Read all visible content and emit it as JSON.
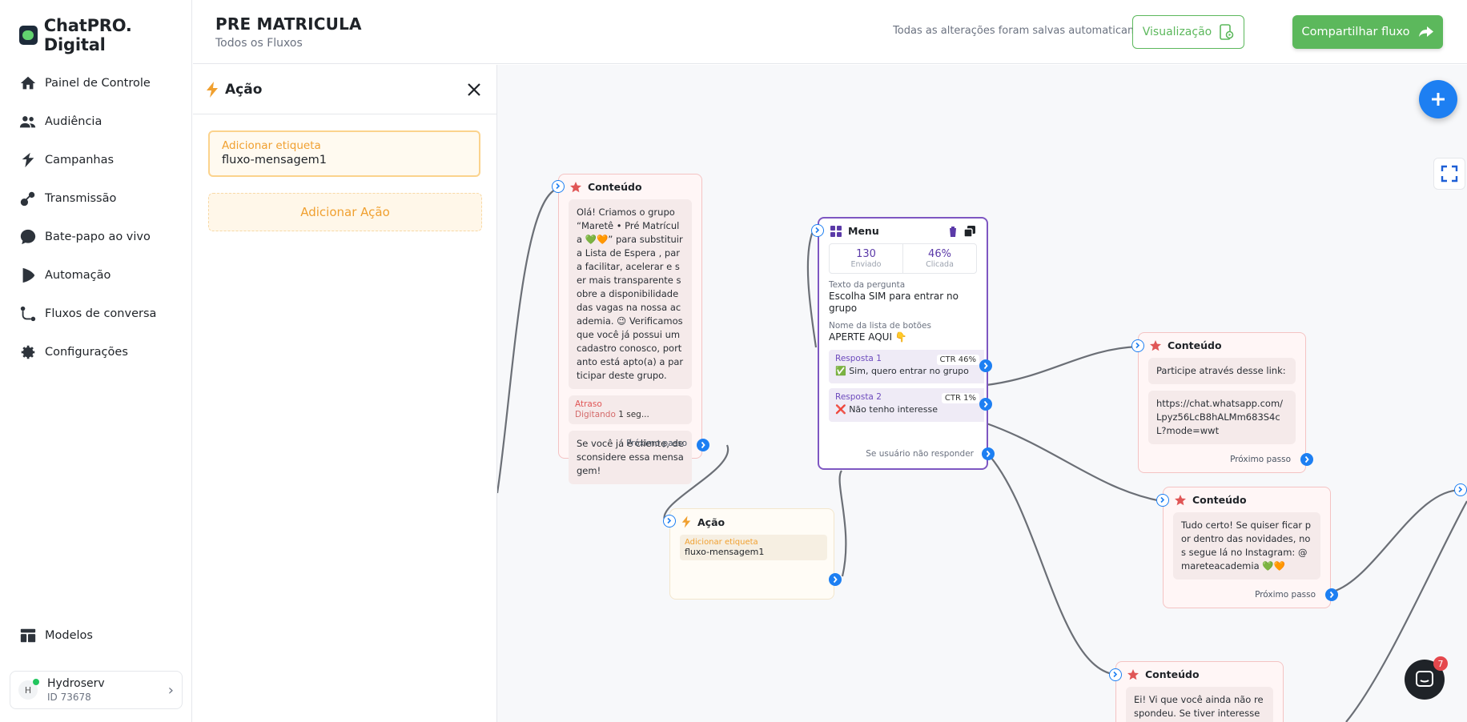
{
  "brand": {
    "name": "ChatPRO. Digital"
  },
  "nav": {
    "items": [
      {
        "label": "Painel de Controle"
      },
      {
        "label": "Audiência"
      },
      {
        "label": "Campanhas"
      },
      {
        "label": "Transmissão"
      },
      {
        "label": "Bate-papo ao vivo"
      },
      {
        "label": "Automação"
      },
      {
        "label": "Fluxos de conversa"
      },
      {
        "label": "Configurações"
      }
    ],
    "models_label": "Modelos"
  },
  "account": {
    "initial": "H",
    "name": "Hydroserv",
    "id": "ID 73678"
  },
  "header": {
    "title": "PRE MATRICULA",
    "breadcrumb": "Todos os Fluxos",
    "save_status": "Todas as alterações foram salvas automaticamente",
    "preview_label": "Visualização",
    "share_label": "Compartilhar fluxo"
  },
  "panel": {
    "title": "Ação",
    "tag_label": "Adicionar etiqueta",
    "tag_value": "fluxo-mensagem1",
    "add_action_label": "Adicionar Ação"
  },
  "canvas": {
    "node_content_1": {
      "title": "Conteúdo",
      "message": "Olá! Criamos o grupo “Maretê • Pré Matrícula 💚🧡” para substituir a Lista de Espera , para facilitar, acelerar e ser mais transparente sobre a disponibilidade das vagas na nossa academia. 😉 Verificamos que você já possui um cadastro conosco, portanto está apto(a) a participar deste grupo.",
      "delay_label": "Atraso",
      "delay_typing": "Digitando",
      "delay_value": "1 seg...",
      "message_2": "Se você já é cliente, desconsidere essa mensagem!",
      "next_step": "Próximo passo"
    },
    "node_menu": {
      "title": "Menu",
      "sent_value": "130",
      "sent_label": "Enviado",
      "clicked_value": "46%",
      "clicked_label": "Clicada",
      "question_label": "Texto da pergunta",
      "question_value": "Escolha SIM para entrar no grupo",
      "list_label": "Nome da lista de botões",
      "list_value": "APERTE AQUI 👇",
      "answers": [
        {
          "num": "Resposta 1",
          "ctr": "CTR 46%",
          "text": "✅ Sim, quero entrar no grupo"
        },
        {
          "num": "Resposta 2",
          "ctr": "CTR 1%",
          "text": "❌ Não tenho interesse"
        }
      ],
      "no_reply": "Se usuário não responder"
    },
    "node_action": {
      "title": "Ação",
      "tag_label": "Adicionar etiqueta",
      "tag_value": "fluxo-mensagem1"
    },
    "node_content_2": {
      "title": "Conteúdo",
      "message": "Participe através desse link:",
      "link": "https://chat.whatsapp.com/Lpyz56LcB8hALMm683S4cL?mode=wwt",
      "next_step": "Próximo passo"
    },
    "node_content_3": {
      "title": "Conteúdo",
      "message": "Tudo certo! Se quiser ficar por dentro das novidades, nos segue lá no Instagram: @mareteacademia 💚🧡",
      "next_step": "Próximo passo"
    },
    "node_content_4": {
      "title": "Conteúdo",
      "message": "Ei! Vi que você ainda não respondeu. Se tiver interesse em e"
    }
  },
  "chat_widget": {
    "badge": "7"
  },
  "colors": {
    "primary_green": "#5cb85c",
    "blue": "#1d7ff2",
    "menu_purple": "#7e57c2",
    "content_red": "#e05656",
    "action_orange": "#f0a030"
  }
}
